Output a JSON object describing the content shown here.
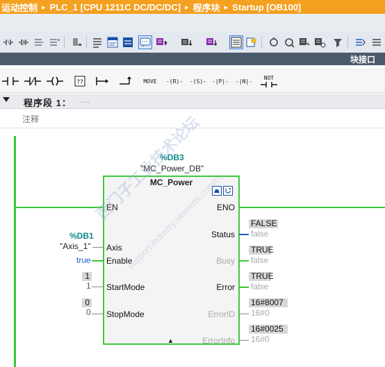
{
  "breadcrumb": [
    "运动控制",
    "PLC_1 [CPU 1211C DC/DC/DC]",
    "程序块",
    "Startup [OB100]"
  ],
  "breadcrumb_sep": "▸",
  "block_interface_label": "块接口",
  "ladder_toolbar": [
    "normally-open-contact",
    "normally-closed-contact",
    "assignment-coil",
    "empty-box",
    "open-branch",
    "close-branch",
    "MOVE",
    "-(R)-",
    "-(S)-",
    "-|P|-",
    "-|N|-",
    "NOT"
  ],
  "ladder_labels": {
    "move": "MOVE",
    "reset": "-(R)-",
    "set": "-(S)-",
    "pos": "-|P|-",
    "neg": "-|N|-",
    "not": "NOT"
  },
  "network": {
    "title": "程序段 1：",
    "dots": ".....",
    "comment": "注释"
  },
  "block": {
    "db": "%DB3",
    "db_name": "\"MC_Power_DB\"",
    "name": "MC_Power",
    "inputs": {
      "en": "EN",
      "axis": "Axis",
      "enable": "Enable",
      "startmode": "StartMode",
      "stopmode": "StopMode"
    },
    "outputs": {
      "eno": "ENO",
      "status": "Status",
      "busy": "Busy",
      "error": "Error",
      "errorid": "ErrorID",
      "errorinfo": "ErrorInfo"
    },
    "expand_arrow": "▲"
  },
  "axis_param": {
    "db": "%DB1",
    "name": "\"Axis_1\""
  },
  "enable_value": "true",
  "startmode_value": {
    "monitor": "1",
    "param": "1"
  },
  "stopmode_value": {
    "monitor": "0",
    "param": "0"
  },
  "status_out": {
    "monitor": "FALSE",
    "actual": "false"
  },
  "busy_out": {
    "monitor": "TRUE",
    "actual": "false"
  },
  "error_out": {
    "monitor": "TRUE",
    "actual": "false"
  },
  "errorid_out": {
    "monitor": "16#8007",
    "actual": "16#0"
  },
  "errorinfo_out": {
    "monitor": "16#0025",
    "actual": "16#0"
  },
  "watermark": {
    "main": "西门子工业技术论坛",
    "sub": "support.industry.siemens.com/cs"
  },
  "colors": {
    "breadcrumb": "#f4a020",
    "powerflow": "#37c837",
    "db_text": "#138a8a",
    "signal_blue": "#1860c8"
  }
}
